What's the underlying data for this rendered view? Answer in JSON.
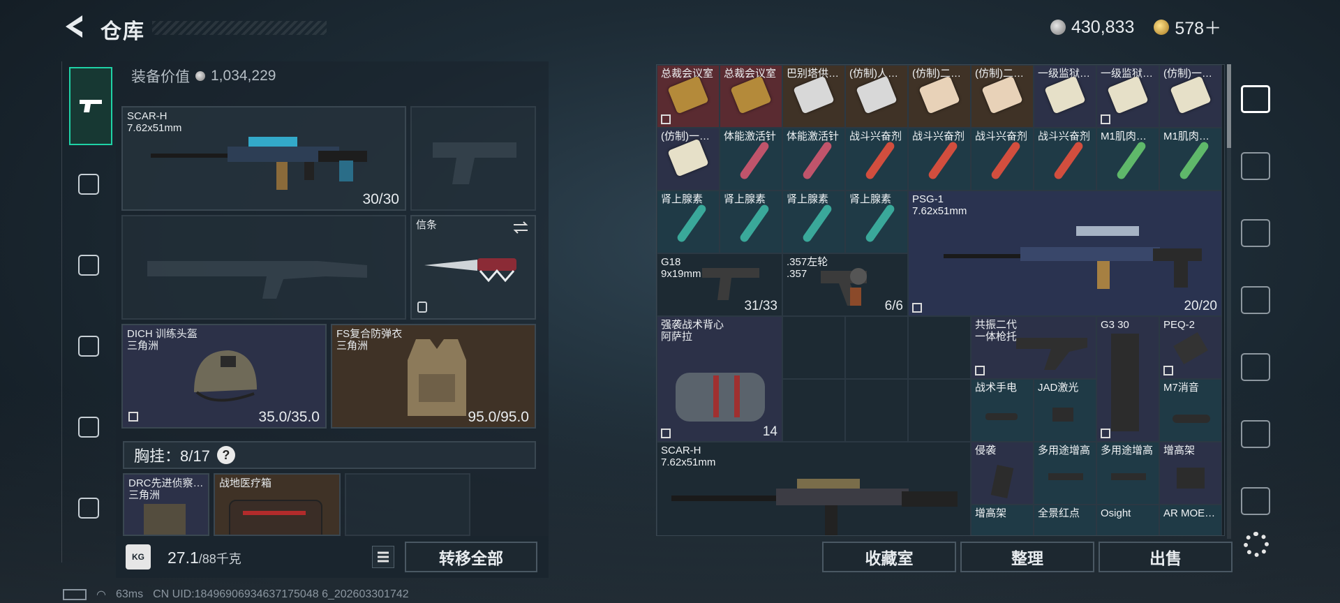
{
  "header": {
    "title": "仓库",
    "currency_silver": "430,833",
    "currency_gold": "578＋"
  },
  "loadout": {
    "equip_value_label": "装备价值",
    "equip_value": "1,034,229",
    "primary": {
      "name": "SCAR-H\n7.62x51mm",
      "ammo": "30/30"
    },
    "knife": {
      "name": "信条"
    },
    "helmet": {
      "name": "DICH 训练头盔\n三角洲",
      "durability": "35.0/35.0"
    },
    "armor": {
      "name": "FS复合防弹衣\n三角洲",
      "durability": "95.0/95.0"
    },
    "chest_rig": "胸挂：8/17",
    "chest_help": "?",
    "rig_items": [
      {
        "name": "DRC先进侦察…\n三角洲"
      },
      {
        "name": "战地医疗箱"
      }
    ],
    "weight": "27.1",
    "weight_max": "/88千克",
    "weight_icon": "KG",
    "transfer_all": "转移全部"
  },
  "stash": {
    "row1": [
      "总裁会议室",
      "总裁会议室",
      "巴别塔供…",
      "(仿制)人…",
      "(仿制)二…",
      "(仿制)二…",
      "一级监狱…",
      "一级监狱…",
      "(仿制)一…"
    ],
    "row2": [
      "(仿制)一…",
      "体能激活针",
      "体能激活针",
      "战斗兴奋剂",
      "战斗兴奋剂",
      "战斗兴奋剂",
      "战斗兴奋剂",
      "M1肌肉…",
      "M1肌肉…"
    ],
    "row3": [
      "肾上腺素",
      "肾上腺素",
      "肾上腺素",
      "肾上腺素"
    ],
    "psg1": {
      "name": "PSG-1\n7.62x51mm",
      "ammo": "20/20"
    },
    "g18": {
      "name": "G18\n9x19mm",
      "ammo": "31/33"
    },
    "revolver": {
      "name": ".357左轮\n.357",
      "ammo": "6/6"
    },
    "backpack": {
      "name": "强袭战术背心\n阿萨拉",
      "count": "14"
    },
    "stock": {
      "name": "共振二代\n一体枪托"
    },
    "g3mag": {
      "name": "G3 30"
    },
    "peq": {
      "name": "PEQ-2"
    },
    "flashlight": {
      "name": "战术手电"
    },
    "jad": {
      "name": "JAD激光"
    },
    "m7": {
      "name": "M7消音"
    },
    "scar2": {
      "name": "SCAR-H\n7.62x51mm"
    },
    "row6": [
      "侵袭",
      "多用途增高",
      "多用途增高",
      "增高架"
    ],
    "row7": [
      "增高架",
      "全景红点",
      "Osight",
      "AR MOE…"
    ]
  },
  "actions": {
    "collection": "收藏室",
    "sort": "整理",
    "sell": "出售"
  },
  "status": {
    "ping": "63ms",
    "uid": "CN UID:18496906934637175048 6_202603301742"
  },
  "colors": {
    "accent": "#1fd2a6",
    "legendary_red": "#5a2b31",
    "epic_navy": "#2c3148",
    "rare_brown": "#3f3226"
  }
}
